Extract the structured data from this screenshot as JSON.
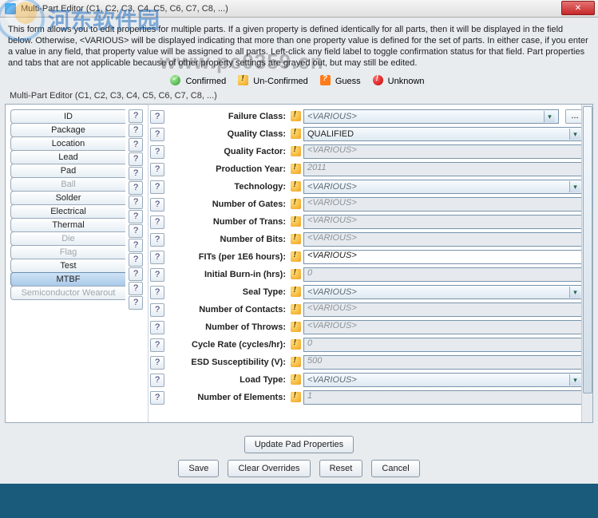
{
  "window": {
    "title": "Multi-Part Editor (C1, C2, C3, C4, C5, C6, C7, C8, ...)"
  },
  "intro": "This form allows you to edit properties for multiple parts. If a given property is defined identically for all parts, then it will be displayed in the field below. Otherwise, <VARIOUS> will be displayed indicating that more than one property value is defined for the set of parts. In either case, if you enter a value in any field, that property value will be assigned to all parts. Left-click any field label to toggle confirmation status for that field. Part properties and tabs that are not applicable because of other property settings are grayed out, but may still be edited.",
  "legend": {
    "confirmed": "Confirmed",
    "unconfirmed": "Un-Confirmed",
    "guess": "Guess",
    "unknown": "Unknown"
  },
  "subtitle": "Multi-Part Editor (C1, C2, C3, C4, C5, C6, C7, C8, ...)",
  "tabs": [
    {
      "label": "ID",
      "enabled": true,
      "active": false
    },
    {
      "label": "Package",
      "enabled": true,
      "active": false
    },
    {
      "label": "Location",
      "enabled": true,
      "active": false
    },
    {
      "label": "Lead",
      "enabled": true,
      "active": false
    },
    {
      "label": "Pad",
      "enabled": true,
      "active": false
    },
    {
      "label": "Ball",
      "enabled": false,
      "active": false
    },
    {
      "label": "Solder",
      "enabled": true,
      "active": false
    },
    {
      "label": "Electrical",
      "enabled": true,
      "active": false
    },
    {
      "label": "Thermal",
      "enabled": true,
      "active": false
    },
    {
      "label": "Die",
      "enabled": false,
      "active": false
    },
    {
      "label": "Flag",
      "enabled": false,
      "active": false
    },
    {
      "label": "Test",
      "enabled": true,
      "active": false
    },
    {
      "label": "MTBF",
      "enabled": true,
      "active": true
    },
    {
      "label": "Semiconductor Wearout",
      "enabled": false,
      "active": false
    }
  ],
  "fields": [
    {
      "label": "Failure Class:",
      "type": "combo",
      "value": "<VARIOUS>",
      "extra": "dots",
      "status": "unconf"
    },
    {
      "label": "Quality Class:",
      "type": "combo",
      "value": "QUALIFIED",
      "status": "unconf",
      "normal": true
    },
    {
      "label": "Quality Factor:",
      "type": "text",
      "value": "<VARIOUS>",
      "status": "unconf"
    },
    {
      "label": "Production Year:",
      "type": "text",
      "value": "2011",
      "status": "unconf"
    },
    {
      "label": "Technology:",
      "type": "combo",
      "value": "<VARIOUS>",
      "status": "unconf"
    },
    {
      "label": "Number of Gates:",
      "type": "text",
      "value": "<VARIOUS>",
      "status": "unconf"
    },
    {
      "label": "Number of Trans:",
      "type": "text",
      "value": "<VARIOUS>",
      "status": "unconf"
    },
    {
      "label": "Number of Bits:",
      "type": "text",
      "value": "<VARIOUS>",
      "status": "unconf"
    },
    {
      "label": "FITs (per 1E6 hours):",
      "type": "text",
      "value": "<VARIOUS>",
      "status": "unconf",
      "enabled": true
    },
    {
      "label": "Initial Burn-in (hrs):",
      "type": "text",
      "value": "0",
      "status": "unconf"
    },
    {
      "label": "Seal Type:",
      "type": "combo",
      "value": "<VARIOUS>",
      "status": "unconf"
    },
    {
      "label": "Number of Contacts:",
      "type": "text",
      "value": "<VARIOUS>",
      "status": "unconf"
    },
    {
      "label": "Number of Throws:",
      "type": "text",
      "value": "<VARIOUS>",
      "status": "unconf"
    },
    {
      "label": "Cycle Rate (cycles/hr):",
      "type": "text",
      "value": "0",
      "status": "unconf"
    },
    {
      "label": "ESD Susceptibility (V):",
      "type": "text",
      "value": "500",
      "status": "unconf"
    },
    {
      "label": "Load Type:",
      "type": "combo",
      "value": "<VARIOUS>",
      "status": "unconf"
    },
    {
      "label": "Number of Elements:",
      "type": "text",
      "value": "1",
      "status": "unconf"
    }
  ],
  "buttons": {
    "update": "Update Pad Properties",
    "save": "Save",
    "clear": "Clear Overrides",
    "reset": "Reset",
    "cancel": "Cancel"
  },
  "watermark": {
    "brand": "河东软件园",
    "url": "www.pc0359.cn"
  }
}
